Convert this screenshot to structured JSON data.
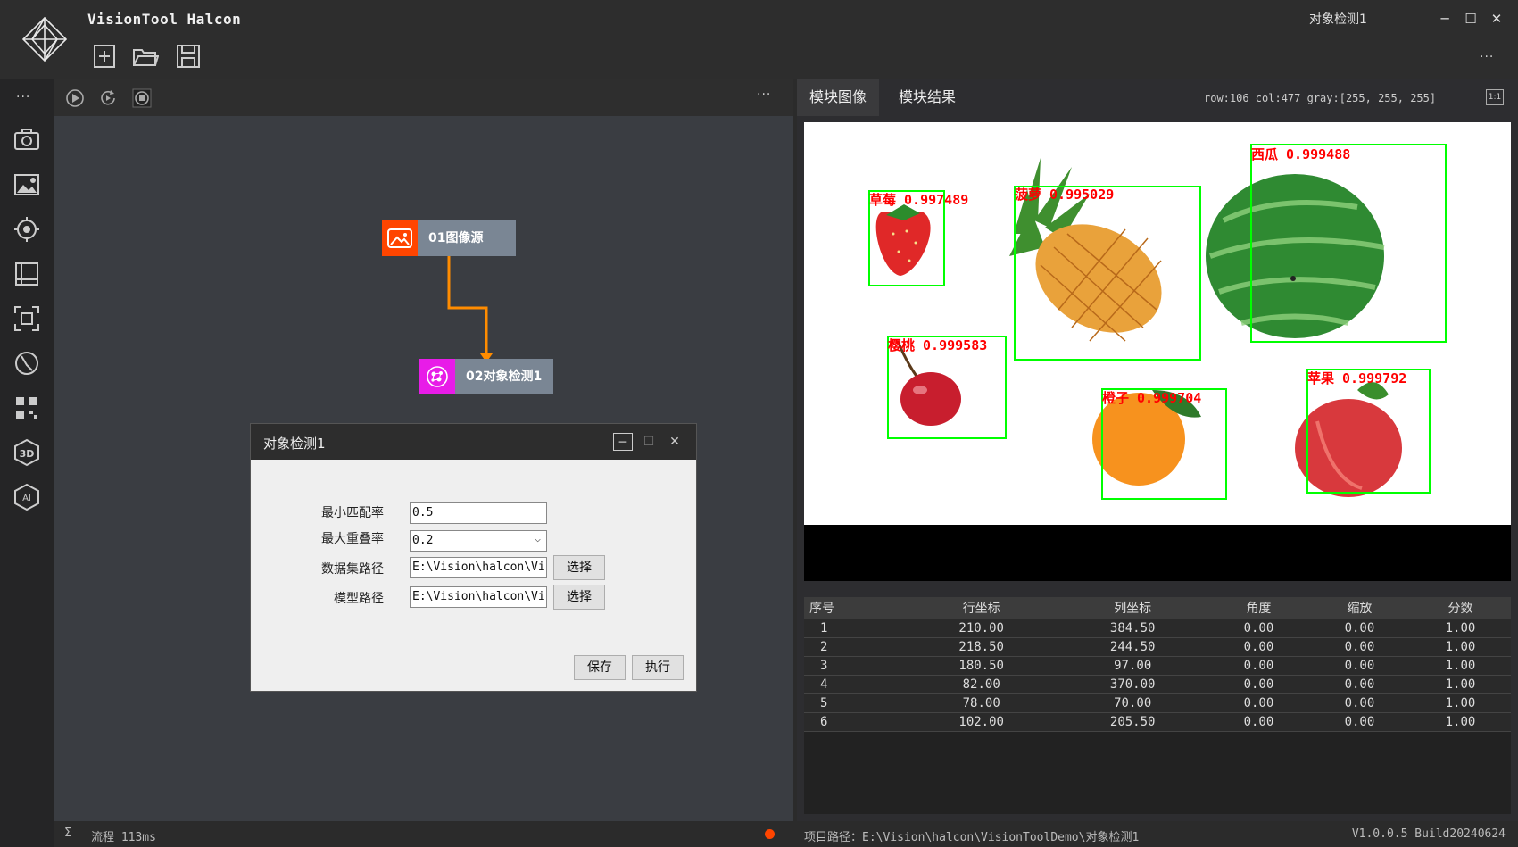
{
  "app": {
    "title": "VisionTool Halcon",
    "window_title": "对象检测1"
  },
  "title_more": "···",
  "left_toolbar_more": "···",
  "flow_toolbar_more": "···",
  "nodes": [
    {
      "label": "01图像源",
      "color": "#ff4500"
    },
    {
      "label": "02对象检测1",
      "color": "#e81ce8"
    }
  ],
  "flow_status": {
    "sigma": "Σ",
    "text": "流程 113ms"
  },
  "dialog": {
    "title": "对象检测1",
    "fields": [
      {
        "label": "最小匹配率",
        "value": "0.5"
      },
      {
        "label": "最大重叠率",
        "value": "0.2"
      },
      {
        "label": "数据集路径",
        "value": "E:\\Vision\\halcon\\Vi",
        "button": "选择"
      },
      {
        "label": "模型路径",
        "value": "E:\\Vision\\halcon\\Vi",
        "button": "选择"
      }
    ],
    "save": "保存",
    "execute": "执行"
  },
  "tabs": [
    "模块图像",
    "模块结果"
  ],
  "pixel_info": "row:106 col:477 gray:[255, 255, 255]",
  "ratio": "1:1",
  "detections": [
    {
      "label": "草莓 0.997489",
      "color": "#ff0000"
    },
    {
      "label": "菠萝 0.995029",
      "color": "#ff0000"
    },
    {
      "label": "西瓜 0.999488",
      "color": "#ff0000"
    },
    {
      "label": "樱桃 0.999583",
      "color": "#ff0000"
    },
    {
      "label": "橙子 0.999704",
      "color": "#ff0000"
    },
    {
      "label": "苹果 0.999792",
      "color": "#ff0000"
    }
  ],
  "table": {
    "headers": [
      "序号",
      "行坐标",
      "列坐标",
      "角度",
      "缩放",
      "分数"
    ],
    "rows": [
      [
        "1",
        "210.00",
        "384.50",
        "0.00",
        "0.00",
        "1.00"
      ],
      [
        "2",
        "218.50",
        "244.50",
        "0.00",
        "0.00",
        "1.00"
      ],
      [
        "3",
        "180.50",
        "97.00",
        "0.00",
        "0.00",
        "1.00"
      ],
      [
        "4",
        "82.00",
        "370.00",
        "0.00",
        "0.00",
        "1.00"
      ],
      [
        "5",
        "78.00",
        "70.00",
        "0.00",
        "0.00",
        "1.00"
      ],
      [
        "6",
        "102.00",
        "205.50",
        "0.00",
        "0.00",
        "1.00"
      ]
    ]
  },
  "right_status": {
    "path": "项目路径：E:\\Vision\\halcon\\VisionToolDemo\\对象检测1",
    "version": "V1.0.0.5 Build20240624"
  }
}
